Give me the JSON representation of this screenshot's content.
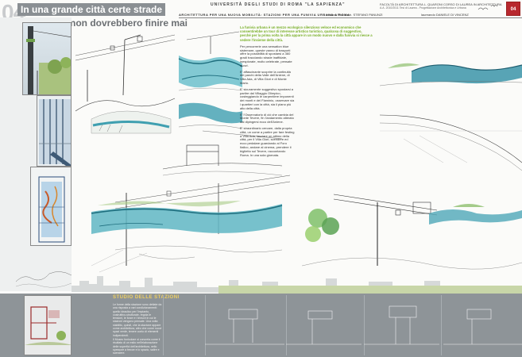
{
  "header": {
    "number": "04",
    "title_line1": "In una grande città certe strade",
    "title_line2": "non dovrebbero finire mai",
    "university": "UNIVERSITÀ DEGLI STUDI DI ROMA \"LA SAPIENZA\"",
    "department": "FACOLTÀ DI ARCHITETTURA L. QUARONI   CORSO DI LAUREA IN ARCHITETTURA",
    "subtitle": "A.A. 2010/2011 Tesi di Laurea - Progettazione Architettonica e Urbana",
    "project": "ARCHITETTURA PER UNA NUOVA MOBILITÀ: STAZIONI PER UNA FUNIVIA URBANA A ROMA",
    "relatore": "relatore Prof. Arch. STEFANO PANUNZI",
    "laureando": "laureando DANIELE DI VINCENZ",
    "logo": "04"
  },
  "text_column": {
    "lead": "La funivia urbana è un mezzo ecologico silenzioso veloce ed economico che consentirebbe un tour di interesse artistico turistico, qualcosa di suggestivo, perché per la prima volta la città appare in un modo nuovo e dalla funivia si riesce a vedere l'insieme della città.",
    "paragraphs": [
      "Per percorrerle una sensation blue sistemare, queste vanno di trasporti offre la possibilità di spostarsi a 360 gradi tracciando strade inaffidate, inesplorate, molto celebrate, pensate nuovi.",
      "E' affascinante scoprire la continuità dei parchi della Valle dell'Aniene, di Villa Ada, di Villa Glori e di Monte Mario.",
      "E' sicuramente suggestivo spostarsi a partire dal Villaggio Olimpico, costeggiando le carpentiere imponenti dei monti e del Flaminio, osservare sia i quartieri con la città, sia il piano più alto della città.",
      "E' l'Osservatorio di ciò che cambia del Monte Tevere, fin l'andamento alterato dal dipingersi ecco dell'Aniene.",
      "E' straordinario cercare, dalla propria città, un come a partire per fare festing a Villa Ada, lasciare un attimo della città, per il Villa Glori, scendere ed ecco pedalare guardando al Foro Italico, andare al cinema, prendere il biglietto sul Tevere, raccontando Roma. In una sola giornata."
    ]
  },
  "stations": {
    "title": "STUDIO DELLE STAZIONI",
    "text": "Le forme della stazione sono dettate da una risposta a vari condizionamenti: quello idraulico per l'impianto, costruttivo-strutturale, regola le tensioni, le forze e i tensori in cui le stazioni vengono pensate. Una volta stabilito, quindi, che la stazione appare come architettura, altro che come nuovi spazi verde, tenere conto di elementi indipendenti.",
    "text2": "Il Museo funicolare si concreta come il risultato di un esito nell'elaborazione delle superfici dell'architettura, nello spessore a frecce e lo spazio, salire e scendere."
  },
  "colors": {
    "accent_green": "#7ab02a",
    "water_teal": "#3f9fb0",
    "water_dark": "#1e6e7e",
    "bottom_band": "#8e9498",
    "stations_title": "#f0d060",
    "logo_red": "#b8282e"
  }
}
